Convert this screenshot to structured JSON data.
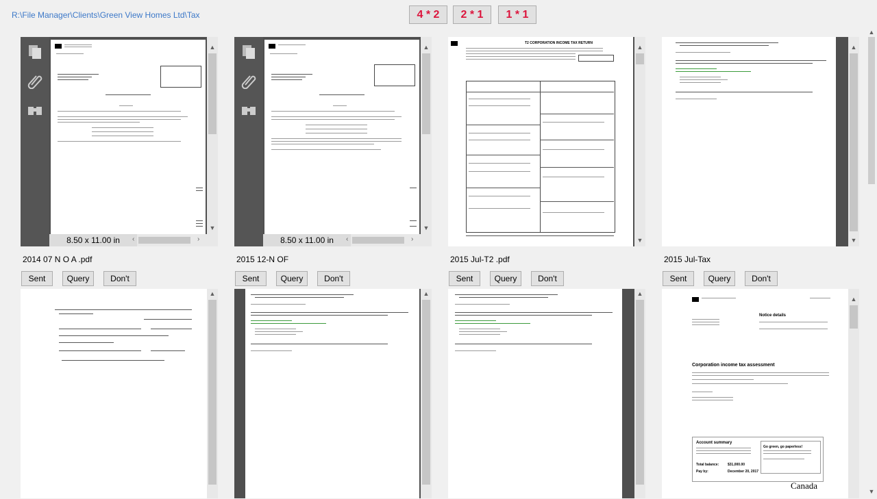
{
  "path": "R:\\File Manager\\Clients\\Green View Homes Ltd\\Tax",
  "layouts": [
    "4 * 2",
    "2 * 1",
    "1 * 1"
  ],
  "page_size": "8.50 x 11.00 in",
  "actions": {
    "sent": "Sent",
    "query": "Query",
    "dont": "Don't"
  },
  "files": [
    {
      "name": "2014 07 N O A .pdf"
    },
    {
      "name": "2015 12-N OF"
    },
    {
      "name": "2015 Jul-T2 .pdf"
    },
    {
      "name": "2015 Jul-Tax"
    }
  ],
  "thumb_text": {
    "t2_title": "T2 CORPORATION INCOME TAX RETURN",
    "notice_title": "Corporation income tax assessment",
    "notice_details": "Notice details",
    "account_summary": "Account summary",
    "go_green": "Go green, go paperless!",
    "total_balance_label": "Total balance:",
    "total_balance_value": "$31,000.00",
    "pay_by_label": "Pay by:",
    "pay_by_value": "December 20, 2017",
    "canada": "Canada"
  }
}
